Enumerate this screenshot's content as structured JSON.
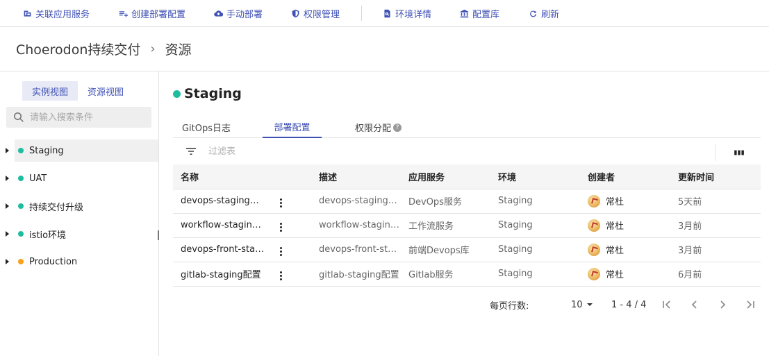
{
  "toolbar": {
    "items": [
      {
        "label": "关联应用服务",
        "icon": "link-icon"
      },
      {
        "label": "创建部署配置",
        "icon": "playlist-add-icon"
      },
      {
        "label": "手动部署",
        "icon": "cloud-deploy-icon"
      },
      {
        "label": "权限管理",
        "icon": "shield-icon"
      },
      {
        "label": "环境详情",
        "icon": "file-search-icon"
      },
      {
        "label": "配置库",
        "icon": "bank-icon"
      },
      {
        "label": "刷新",
        "icon": "refresh-icon"
      }
    ]
  },
  "breadcrumb": {
    "project": "Choerodon持续交付",
    "page": "资源"
  },
  "sidebar": {
    "view_tabs": [
      "实例视图",
      "资源视图"
    ],
    "search_placeholder": "请输入搜索条件",
    "environments": [
      {
        "label": "Staging",
        "status_color": "#1fbd9f"
      },
      {
        "label": "UAT",
        "status_color": "#1fbd9f"
      },
      {
        "label": "持续交付升级",
        "status_color": "#1fbd9f"
      },
      {
        "label": "istio环境",
        "status_color": "#1fbd9f"
      },
      {
        "label": "Production",
        "status_color": "#f7a11c"
      }
    ]
  },
  "main": {
    "env_name": "Staging",
    "env_status_color": "#1fbd9f",
    "tabs": [
      "GitOps日志",
      "部署配置",
      "权限分配"
    ],
    "active_tab": "部署配置",
    "filter_placeholder": "过滤表",
    "table": {
      "headers": [
        "名称",
        "描述",
        "应用服务",
        "环境",
        "创建者",
        "更新时间"
      ],
      "rows": [
        {
          "name": "devops-staging…",
          "desc": "devops-staging…",
          "service": "DevOps服务",
          "env": "Staging",
          "creator": "常杜",
          "updated": "5天前"
        },
        {
          "name": "workflow-stagin…",
          "desc": "workflow-stagin…",
          "service": "工作流服务",
          "env": "Staging",
          "creator": "常杜",
          "updated": "3月前"
        },
        {
          "name": "devops-front-sta…",
          "desc": "devops-front-sta…",
          "service": "前端Devops库",
          "env": "Staging",
          "creator": "常杜",
          "updated": "3月前"
        },
        {
          "name": "gitlab-staging配置",
          "desc": "gitlab-staging配置",
          "service": "Gitlab服务",
          "env": "Staging",
          "creator": "常杜",
          "updated": "6月前"
        }
      ]
    },
    "pagination": {
      "rows_per_page_label": "每页行数:",
      "page_size": "10",
      "range": "1 - 4 / 4"
    }
  }
}
